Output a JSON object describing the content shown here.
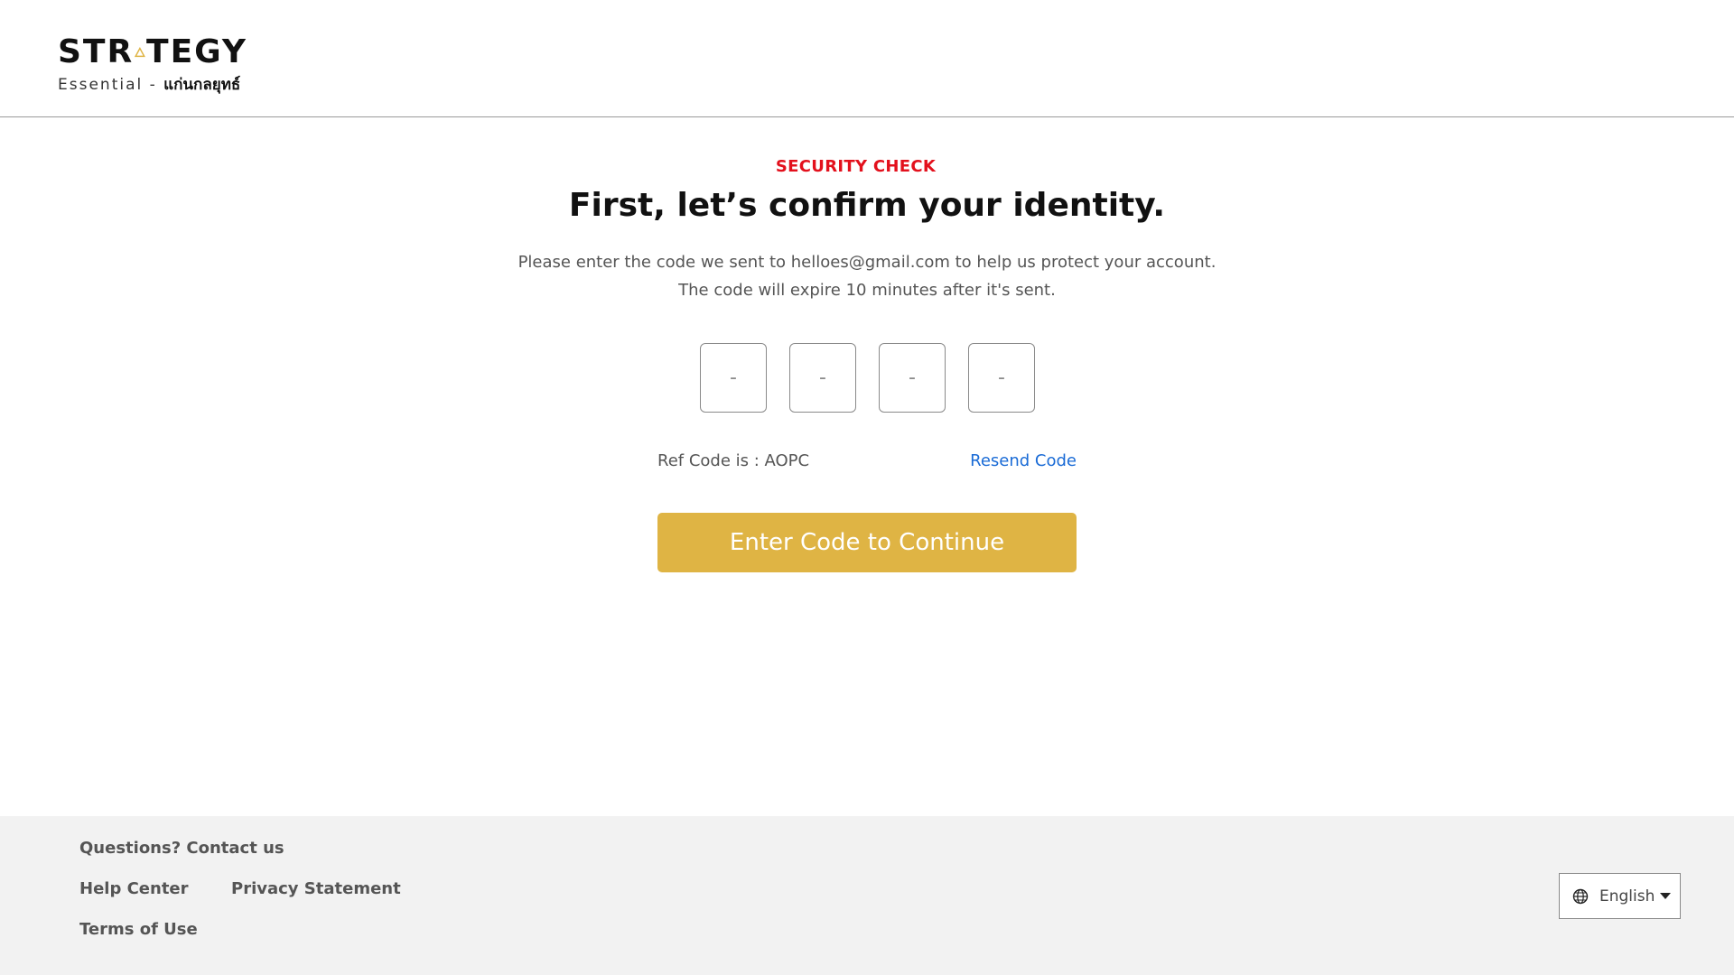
{
  "header": {
    "logo": {
      "brand_left": "STR",
      "brand_right": "TEGY",
      "subtitle": "Essential -",
      "subtitle_thai": "แก่นกลยุทธ์",
      "accent_color": "#dfb444"
    }
  },
  "main": {
    "eyebrow": "SECURITY CHECK",
    "eyebrow_color": "#e3101c",
    "title": "First, let’s confirm your identity.",
    "description_line1": "Please enter the code we sent to helloes@gmail.com to help us protect your account.",
    "description_line2": "The code will expire 10 minutes after it's sent.",
    "otp_inputs": [
      {
        "placeholder": "-",
        "value": ""
      },
      {
        "placeholder": "-",
        "value": ""
      },
      {
        "placeholder": "-",
        "value": ""
      },
      {
        "placeholder": "-",
        "value": ""
      }
    ],
    "ref_code_text": "Ref Code is : AOPC",
    "resend_label": "Resend Code",
    "continue_label": "Enter Code to Continue",
    "button_color": "#dfb444",
    "link_color": "#1a6bd6"
  },
  "footer": {
    "questions_label": "Questions? Contact us",
    "help_center_label": "Help Center",
    "privacy_label": "Privacy Statement",
    "terms_label": "Terms of Use",
    "language": {
      "icon": "globe-icon",
      "selected": "English"
    }
  }
}
